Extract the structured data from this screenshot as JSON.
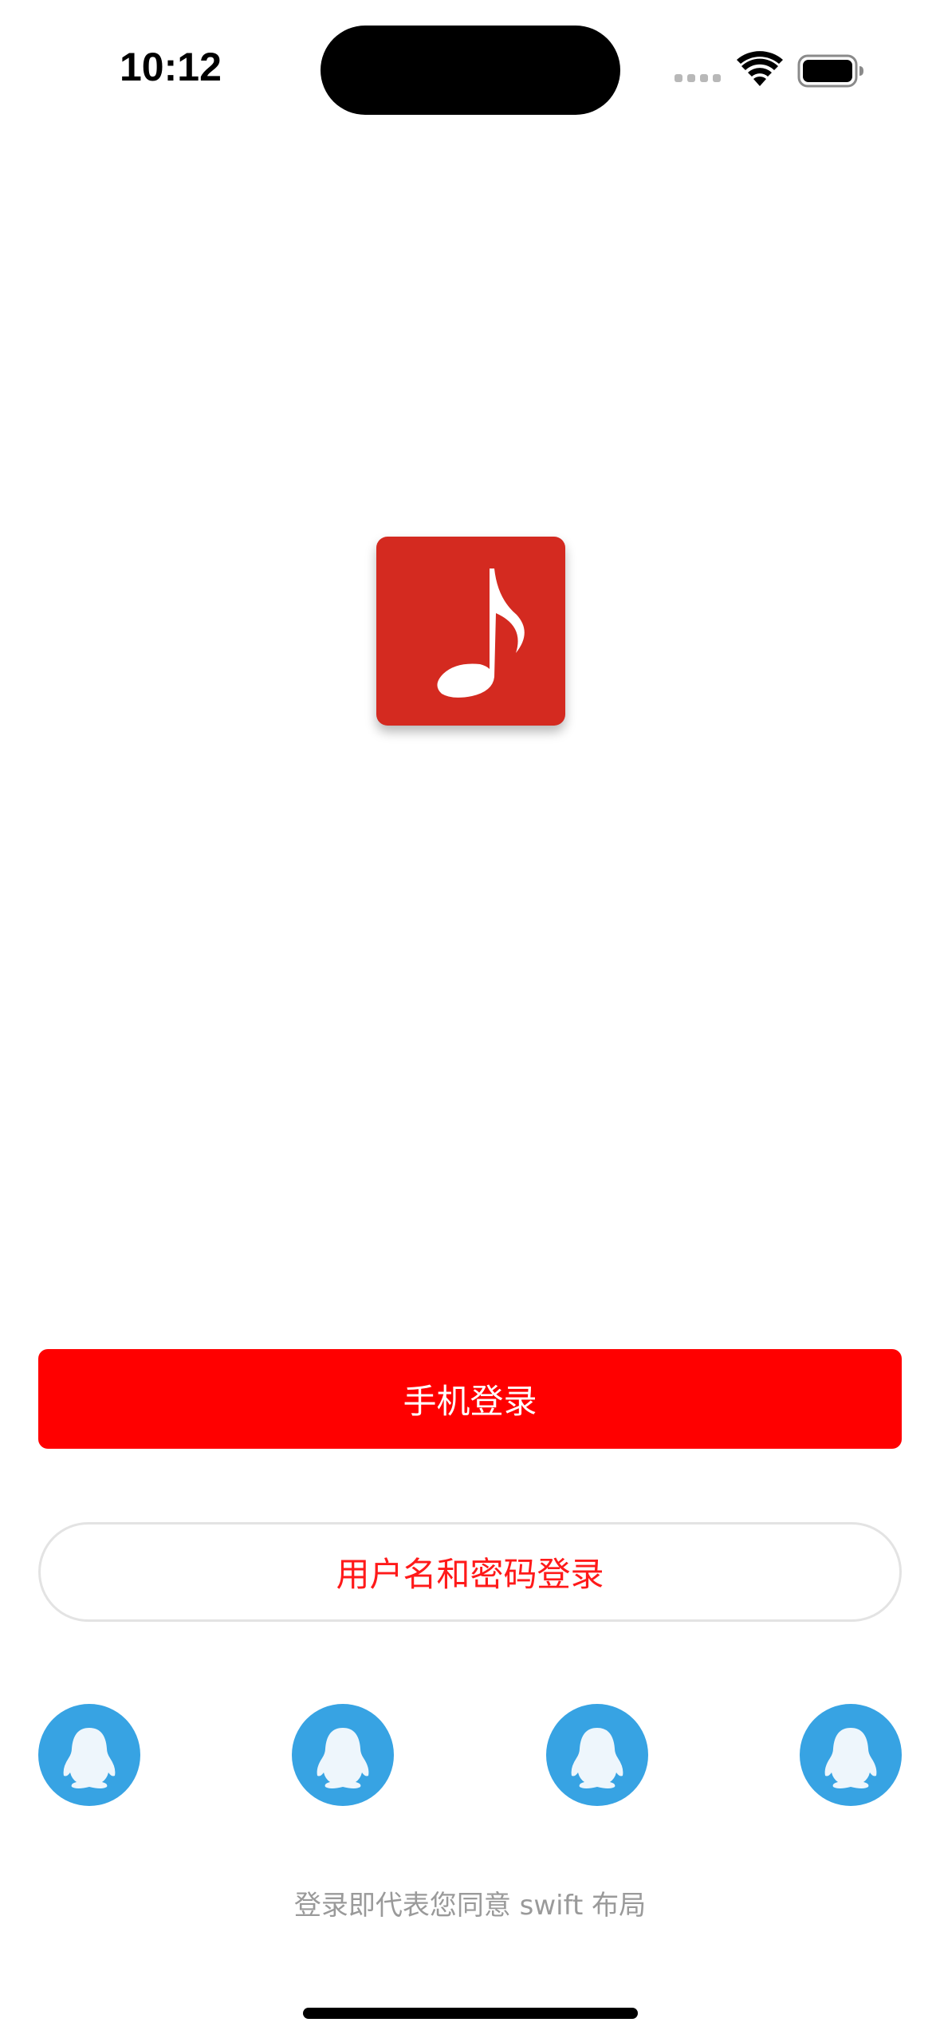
{
  "status_bar": {
    "time": "10:12"
  },
  "logo": {
    "icon": "music-note-icon",
    "background_color": "#d42a20"
  },
  "login": {
    "phone_login_label": "手机登录",
    "password_login_label": "用户名和密码登录",
    "primary_color": "#ff0000"
  },
  "social_login": {
    "icon": "qq-penguin-icon",
    "count": 4,
    "color": "#37a3e3"
  },
  "agreement": {
    "text": "登录即代表您同意 swift 布局"
  }
}
